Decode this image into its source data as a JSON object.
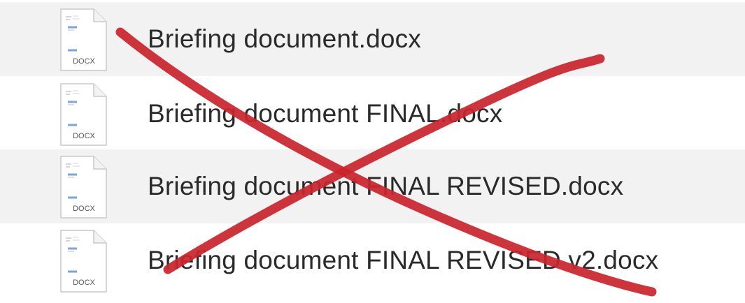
{
  "files": [
    {
      "name": "Briefing document.docx",
      "badge": "DOCX"
    },
    {
      "name": "Briefing document FINAL.docx",
      "badge": "DOCX"
    },
    {
      "name": "Briefing document FINAL REVISED.docx",
      "badge": "DOCX"
    },
    {
      "name": "Briefing document FINAL REVISED v2.docx",
      "badge": "DOCX"
    }
  ],
  "colors": {
    "row_alt": "#f2f2f2",
    "text": "#2a2a2a",
    "strike": "#c9252c",
    "icon_accent": "#7aa7d8"
  },
  "icons": {
    "file": "docx-file-icon",
    "overlay": "red-x-strike"
  }
}
